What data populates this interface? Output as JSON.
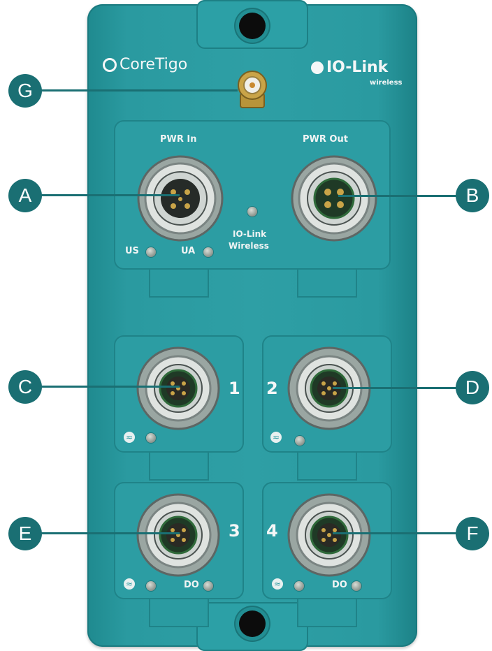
{
  "brand": {
    "left": "CoreTigo",
    "right": "IO-Link",
    "right_sub": "wireless"
  },
  "power": {
    "in_label": "PWR In",
    "out_label": "PWR Out",
    "status_label_1": "IO-Link",
    "status_label_2": "Wireless",
    "us_label": "US",
    "ua_label": "UA"
  },
  "ports": {
    "p1": "1",
    "p2": "2",
    "p3": "3",
    "p4": "4",
    "do_label": "DO"
  },
  "callouts": {
    "a": "A",
    "b": "B",
    "c": "C",
    "d": "D",
    "e": "E",
    "f": "F",
    "g": "G"
  },
  "colors": {
    "device": "#2e9fa5",
    "callout": "#1a6f73",
    "label": "#f4f7f7"
  },
  "icons": [
    "wireless-icon",
    "antenna-connector-icon",
    "m12-connector-icon"
  ]
}
